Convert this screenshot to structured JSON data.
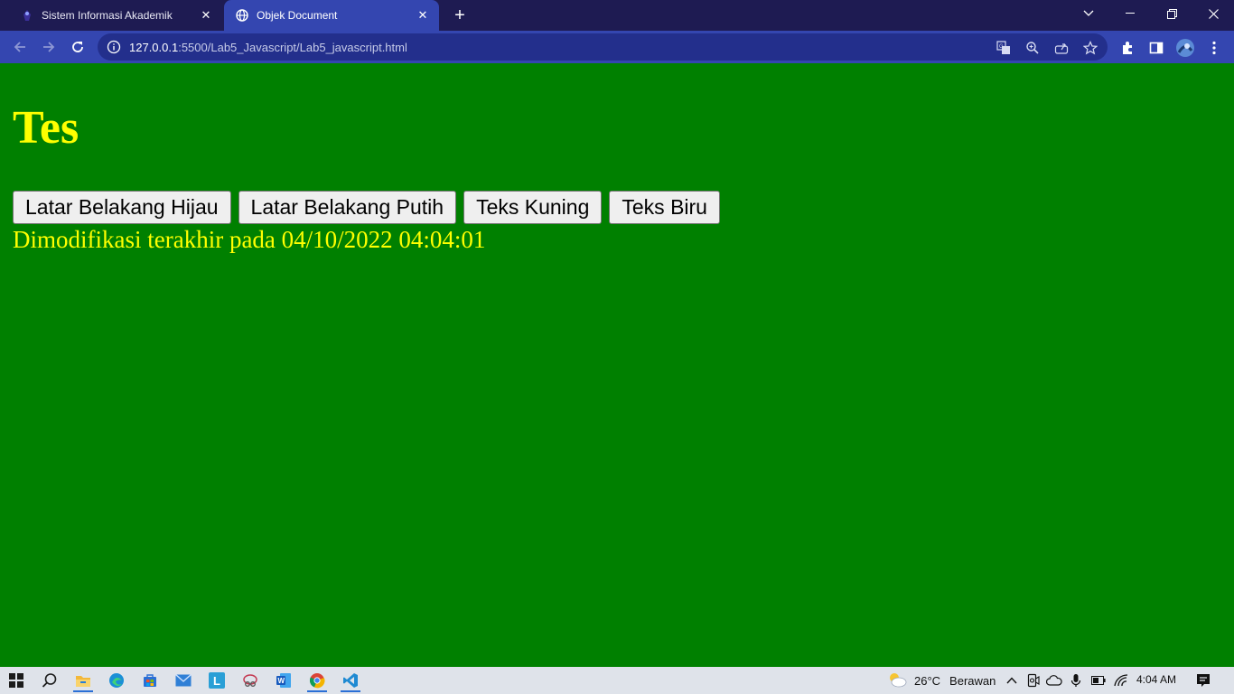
{
  "browser": {
    "tabs": [
      {
        "title": "Sistem Informasi Akademik",
        "active": false
      },
      {
        "title": "Objek Document",
        "active": true
      }
    ],
    "url_host": "127.0.0.1",
    "url_rest": ":5500/Lab5_Javascript/Lab5_javascript.html"
  },
  "page": {
    "heading": "Tes",
    "buttons": [
      "Latar Belakang Hijau",
      "Latar Belakang Putih",
      "Teks Kuning",
      "Teks Biru"
    ],
    "modified_text": "Dimodifikasi terakhir pada 04/10/2022 04:04:01"
  },
  "colors": {
    "page_background": "#008000",
    "page_text": "#ffff00",
    "tab_bar": "#1e1b52",
    "toolbar": "#3446b0"
  },
  "taskbar": {
    "apps": [
      "start-icon",
      "search-icon",
      "file-explorer-icon",
      "edge-icon",
      "store-icon",
      "mail-icon",
      "l-app-icon",
      "snipping-icon",
      "word-icon",
      "chrome-icon",
      "vscode-icon"
    ],
    "weather_temp": "26°C",
    "weather_desc": "Berawan",
    "time": "4:04 AM"
  }
}
